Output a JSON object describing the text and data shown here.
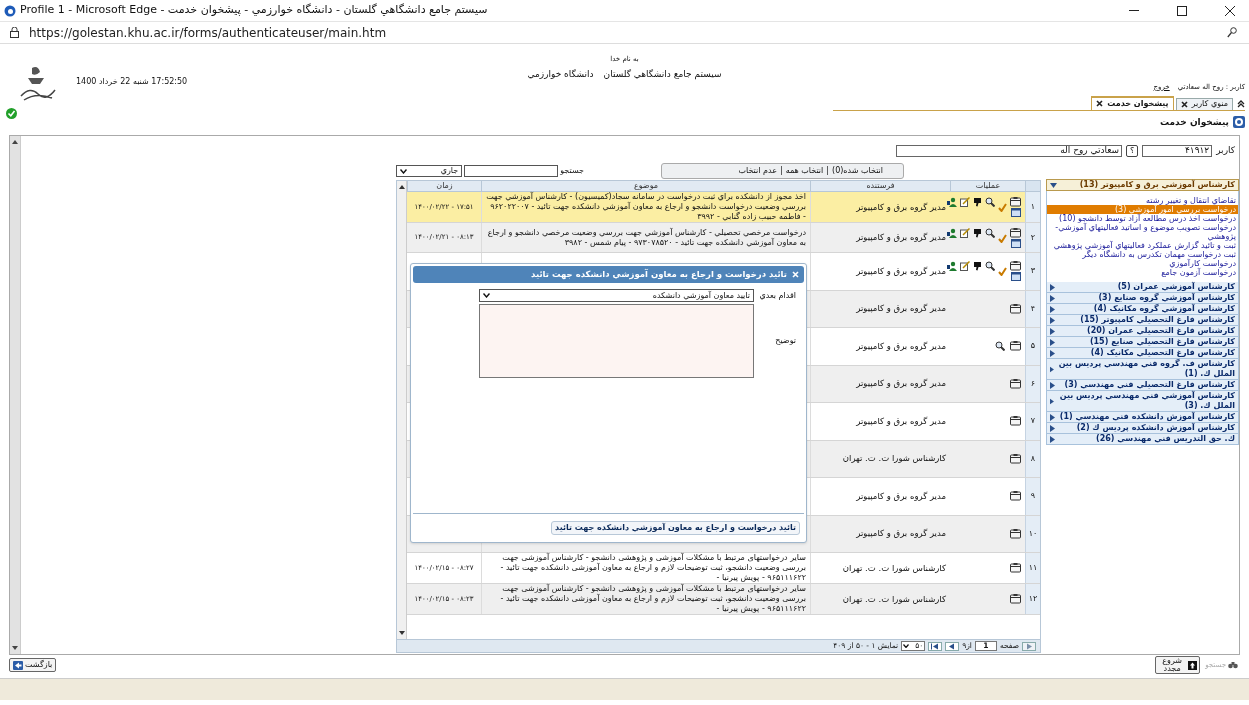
{
  "window": {
    "title": "سيستم جامع دانشگاهي گلستان - دانشگاه خوارزمي - پيشخوان خدمت - Profile 1 - Microsoft Edge",
    "url": "https://golestan.khu.ac.ir/forms/authenticateuser/main.htm"
  },
  "header": {
    "bismillah": "به نام خدا",
    "system_name": "سيستم جامع دانشگاهي گلستان",
    "university": "دانشگاه خوارزمي",
    "datetime": "17:52:50 شنبه 22 خرداد 1400",
    "user_label": "کاربر : روح اله سعادتي",
    "logout": "خروج"
  },
  "tabs": [
    {
      "label": "منوي کاربر",
      "selected": false
    },
    {
      "label": "پيشخوان خدمت",
      "selected": true
    }
  ],
  "page_title": "پيشخوان خدمت",
  "user_row": {
    "label": "کاربر",
    "code": "۴۱۹۱۲",
    "help": "؟",
    "name": "سعادتي روح اله"
  },
  "toolbar": {
    "selection": [
      "انتخاب شده(0)",
      "انتخاب همه",
      "عدم انتخاب"
    ],
    "separator": "|",
    "search_label": "جستجو",
    "filter": "جاري"
  },
  "table": {
    "columns": [
      "عمليات",
      "فرستنده",
      "موضوع",
      "زمان"
    ],
    "rows": [
      {
        "number": "۱",
        "kind": "full",
        "sender": "مدير گروه برق و کامپيوتر",
        "subject": "اخذ مجوز از دانشکده براي ثبت درخواست در سامانه سجاد(کميسيون) - کارشناس آموزشي جهت بررسي وضعيت درخواست دانشجو و ارجاع به معاون آموزشي دانشکده جهت تائيد - ۹۶۲۰۲۲۰۰۷ - فاطمه حبيب زاده گنابي - ۳۹۹۲",
        "time": "۱۴۰۰/۰۲/۲۲ - ۱۷:۵۱",
        "selected": true
      },
      {
        "number": "۲",
        "kind": "full",
        "sender": "مدير گروه برق و کامپيوتر",
        "subject": "درخواست مرخصي تحصيلي - کارشناس آموزشي جهت بررسي وضعيت مرخصي دانشجو و ارجاع به معاون آموزشي دانشکده جهت تائيد - ۹۷۳۰۷۸۵۲۰ - پيام شمس - ۳۹۸۲",
        "time": "۱۴۰۰/۰۲/۲۱ - ۰۸:۱۳",
        "selected": false
      },
      {
        "number": "۳",
        "kind": "full",
        "sender": "مدير گروه برق و کامپيوتر",
        "selected": false
      },
      {
        "number": "۴",
        "kind": "view",
        "sender": "مدير گروه برق و کامپيوتر",
        "selected": false
      },
      {
        "number": "۵",
        "kind": "view_search",
        "sender": "مدير گروه برق و کامپيوتر",
        "selected": false
      },
      {
        "number": "۶",
        "kind": "view",
        "sender": "مدير گروه برق و کامپيوتر",
        "selected": false
      },
      {
        "number": "۷",
        "kind": "view",
        "sender": "مدير گروه برق و کامپيوتر",
        "selected": false
      },
      {
        "number": "۸",
        "kind": "view",
        "sender": "کارشناس شورا ت. ت. تهران",
        "selected": false
      },
      {
        "number": "۹",
        "kind": "view",
        "sender": "مدير گروه برق و کامپيوتر",
        "selected": false
      },
      {
        "number": "۱۰",
        "kind": "view",
        "sender": "مدير گروه برق و کامپيوتر",
        "selected": false
      },
      {
        "number": "۱۱",
        "kind": "view",
        "sender": "کارشناس شورا ت. ت. تهران",
        "subject": "سایر درخواستهای مرتبط با مشکلات آموزشی و پژوهشی دانشجو - کارشناس آموزشی جهت بررسی وضعیت دانشجو، ثبت توضیحات لازم و ارجاع به معاون آموزشی دانشکده جهت تائید - ۹۶۵۱۱۱۶۲۲ - پویش پیرنیا -",
        "time": "۱۴۰۰/۰۲/۱۵ - ۰۸:۲۷",
        "selected": false
      },
      {
        "number": "۱۲",
        "kind": "view",
        "sender": "کارشناس شورا ت. ت. تهران",
        "subject": "سایر درخواستهای مرتبط با مشکلات آموزشی و پژوهشی دانشجو - کارشناس آموزشی جهت بررسی وضعیت دانشجو، ثبت توضیحات لازم و ارجاع به معاون آموزشی دانشکده جهت تائید - ۹۶۵۱۱۱۶۲۲ - پویش پیرنیا -",
        "time": "۱۴۰۰/۰۲/۱۵ - ۰۸:۲۳",
        "selected": false
      }
    ]
  },
  "pager": {
    "page_label": "صفحه",
    "page": "1",
    "of": "از۹",
    "page_size": "۵۰",
    "display": "نمايش ۱ - ۵۰ از ۴۰۹"
  },
  "dialog": {
    "title": "تائيد درخواست و ارجاع به معاون آموزشي دانشکده جهت تائيد",
    "next_action_label": "اقدام بعدي",
    "next_action_value": "تاييد معاون آموزشي دانشکده",
    "description_label": "توضيح",
    "submit": "تائيد درخواست و ارجاع به معاون آموزشي دانشکده جهت تائيد"
  },
  "sidebar": {
    "groups": [
      {
        "label": "کارشناس آموزشي برق و کامپيوتر (13)",
        "expanded": true,
        "children": [
          {
            "label": "تقاضاي انتقال و تغيير رشته",
            "selected": false
          },
          {
            "label": "درخواست بررسي امور آموزشي (3)",
            "selected": true
          },
          {
            "label": "درخواست اخذ درس مطالعه آزاد توسط دانشجو (10)",
            "selected": false
          },
          {
            "label": "درخواست تصويب موضوع و اساتيد فعاليتهاي آموزشي-پژوهشي",
            "selected": false
          },
          {
            "label": "ثبت و تائيد گزارش عملکرد فعاليتهاي آموزشي پژوهشي",
            "selected": false
          },
          {
            "label": "ثبت درخواست مهمان تکدرس به دانشگاه ديگر",
            "selected": false
          },
          {
            "label": "درخواست کارآموزي",
            "selected": false
          },
          {
            "label": "درخواست آزمون جامع",
            "selected": false
          }
        ]
      },
      {
        "label": "کارشناس آموزشي عمران (5)",
        "expanded": false
      },
      {
        "label": "کارشناس آموزشي گروه صنايع (3)",
        "expanded": false
      },
      {
        "label": "کارشناس آموزشي گروه مکانيک (4)",
        "expanded": false
      },
      {
        "label": "کارشناس فارغ التحصيلي کامپيوتر (15)",
        "expanded": false
      },
      {
        "label": "کارشناس فارغ التحصيلي عمران (20)",
        "expanded": false
      },
      {
        "label": "کارشناس فارغ التحصيلي صنايع (15)",
        "expanded": false
      },
      {
        "label": "کارشناس فارغ التحصيلي مکانيک (4)",
        "expanded": false
      },
      {
        "label": "کارشناس ف. گروه فني مهندسي پرديس بين الملل ك. (1)",
        "expanded": false
      },
      {
        "label": "کارشناس فارغ التحصيلي فني مهندسي (3)",
        "expanded": false
      },
      {
        "label": "کارشناس آموزشي فني مهندسي پرديس بين الملل ك. (3)",
        "expanded": false
      },
      {
        "label": "کارشناس آموزش دانشکده فني مهندسي (1)",
        "expanded": false
      },
      {
        "label": "کارشناس آموزش دانشکده پرديس ك (2)",
        "expanded": false
      },
      {
        "label": "ك. حق التدريس فني مهندسي (26)",
        "expanded": false
      }
    ]
  },
  "bottom": {
    "back": "بازگشت",
    "restart": "شروع مجدد",
    "search": "جستجو",
    "search_disabled": true
  }
}
